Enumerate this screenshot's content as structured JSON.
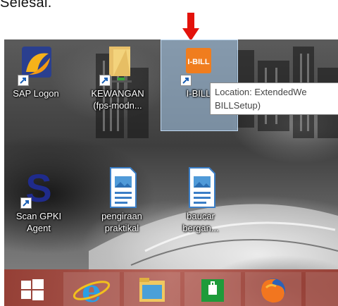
{
  "header": {
    "text": "Selesai."
  },
  "desktop_icons": [
    {
      "name": "icon-sap-logon",
      "label": "SAP Logon"
    },
    {
      "name": "icon-kewangan",
      "label": "KEWANGAN\n(fps-modn..."
    },
    {
      "name": "icon-ibill",
      "label": "I-BILL",
      "badge": "I-BILL"
    },
    {
      "name": "icon-scan-gpki",
      "label": "Scan GPKI\nAgent"
    },
    {
      "name": "icon-pengiraan",
      "label": "pengiraan\npraktikal"
    },
    {
      "name": "icon-baucar",
      "label": "baucar\nbergan..."
    }
  ],
  "tooltip": {
    "line1": "Location: ExtendedWe",
    "line2": "BILLSetup)"
  },
  "taskbar": {
    "items": [
      "start",
      "internet-explorer",
      "file-explorer",
      "store",
      "firefox"
    ]
  },
  "colors": {
    "arrow": "#e3120b",
    "selection": "#aacdf0",
    "ibill_orange": "#f07d1e"
  }
}
